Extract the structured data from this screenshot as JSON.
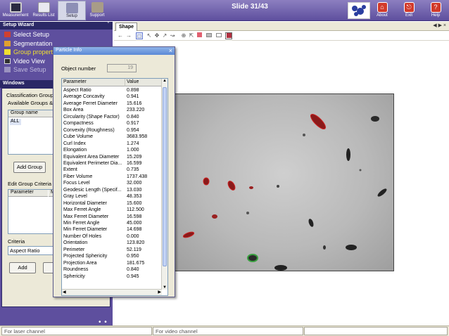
{
  "toolbar": {
    "buttons": [
      {
        "label": "Measurement",
        "icon": "monitor-icon"
      },
      {
        "label": "Results List",
        "icon": "results-list-icon"
      },
      {
        "label": "Setup",
        "icon": "setup-icon",
        "active": true
      },
      {
        "label": "Support",
        "icon": "support-icon"
      }
    ],
    "slide_title": "Slide 31/43",
    "right_buttons": [
      {
        "label": "About",
        "icon": "home-icon"
      },
      {
        "label": "Exit",
        "icon": "exit-icon"
      },
      {
        "label": "Help",
        "icon": "help-icon"
      }
    ]
  },
  "setup_wizard": {
    "title": "Setup Wizard",
    "items": [
      {
        "label": "Select Setup",
        "icon": "select-setup-icon",
        "state": "normal"
      },
      {
        "label": "Segmentation",
        "icon": "segmentation-icon",
        "state": "normal"
      },
      {
        "label": "Group properties",
        "icon": "group-properties-icon",
        "state": "current"
      },
      {
        "label": "Video View",
        "icon": "video-view-icon",
        "state": "normal"
      },
      {
        "label": "Save Setup",
        "icon": "save-setup-icon",
        "state": "disabled"
      }
    ]
  },
  "windows": {
    "title": "Windows",
    "classification_label": "Classification Group",
    "available_groups_label": "Available Groups &",
    "group_name_header": "Group name",
    "groups": [
      "ALL"
    ],
    "add_group_button": "Add Group",
    "edit_criteria_label": "Edit Group Criteria",
    "criteria_headers": [
      "Parameter",
      "M"
    ],
    "criteria_label": "Criteria",
    "criteria_value": "Aspect Ratio",
    "add_button": "Add"
  },
  "shape": {
    "tab_label": "Shape"
  },
  "status_bar": {
    "laser": "For laser channel",
    "video": "For video channel"
  },
  "particle_info": {
    "title": "Particle Info",
    "object_number_label": "Object number",
    "object_number": "19",
    "headers": {
      "param": "Parameter",
      "value": "Value"
    },
    "rows": [
      {
        "param": "Aspect Ratio",
        "value": "0.898"
      },
      {
        "param": "Average Concavity",
        "value": "0.941"
      },
      {
        "param": "Average Ferret Diameter",
        "value": "15.616"
      },
      {
        "param": "Box Area",
        "value": "233.220"
      },
      {
        "param": "Circularity (Shape Factor)",
        "value": "0.840"
      },
      {
        "param": "Compactness",
        "value": "0.917"
      },
      {
        "param": "Convexity (Roughness)",
        "value": "0.954"
      },
      {
        "param": "Cube Volume",
        "value": "3683.958"
      },
      {
        "param": "Curl Index",
        "value": "1.274"
      },
      {
        "param": "Elongation",
        "value": "1.000"
      },
      {
        "param": "Equivalent Area Diameter",
        "value": "15.209"
      },
      {
        "param": "Equivalent Perimeter Dia...",
        "value": "16.599"
      },
      {
        "param": "Extent",
        "value": "0.735"
      },
      {
        "param": "Fiber Volume",
        "value": "1737.438"
      },
      {
        "param": "Focus Level",
        "value": "32.000"
      },
      {
        "param": "Geodesic Length (Specif...",
        "value": "13.030"
      },
      {
        "param": "Gray Level",
        "value": "48.353"
      },
      {
        "param": "Horizontal Diameter",
        "value": "15.600"
      },
      {
        "param": "Max Ferret Angle",
        "value": "112.500"
      },
      {
        "param": "Max Ferret Diameter",
        "value": "16.598"
      },
      {
        "param": "Min Ferret Angle",
        "value": "45.000"
      },
      {
        "param": "Min Ferret Diameter",
        "value": "14.698"
      },
      {
        "param": "Number Of Holes",
        "value": "0.000"
      },
      {
        "param": "Orientation",
        "value": "123.820"
      },
      {
        "param": "Perimeter",
        "value": "52.119"
      },
      {
        "param": "Projected Sphericity",
        "value": "0.950"
      },
      {
        "param": "Projection Area",
        "value": "181.675"
      },
      {
        "param": "Roundness",
        "value": "0.840"
      },
      {
        "param": "Sphericity",
        "value": "0.945"
      }
    ]
  }
}
